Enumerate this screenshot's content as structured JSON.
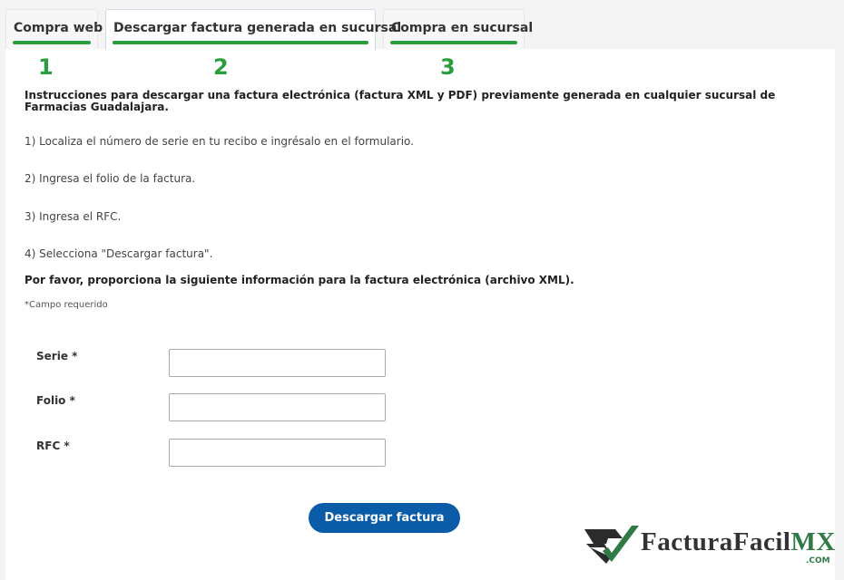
{
  "tabs": [
    {
      "label": "Compra web",
      "active": false
    },
    {
      "label": "Descargar factura generada en sucursal",
      "active": true
    },
    {
      "label": "Compra en sucursal",
      "active": false
    }
  ],
  "step_numbers": [
    "1",
    "2",
    "3"
  ],
  "instructions": {
    "title": "Instrucciones para descargar una factura electrónica (factura XML y PDF) previamente generada en cualquier sucursal de Farmacias Guadalajara.",
    "steps": [
      "1) Localiza el número de serie en tu recibo e ingrésalo en el formulario.",
      "2) Ingresa el folio de la factura.",
      "3) Ingresa el RFC.",
      "4) Selecciona \"Descargar factura\"."
    ]
  },
  "form": {
    "intro": "Por favor, proporciona la siguiente información para la factura electrónica (archivo XML).",
    "required_note": "*Campo requerido",
    "fields": [
      {
        "label": "Serie *",
        "value": ""
      },
      {
        "label": "Folio *",
        "value": ""
      },
      {
        "label": "RFC *",
        "value": ""
      }
    ],
    "submit_label": "Descargar factura"
  },
  "logo": {
    "text_main": "FacturaFacil",
    "text_accent": "MX",
    "sub": ".COM"
  },
  "colors": {
    "accent_green": "#2a9d3f",
    "button_blue": "#0a5ba8",
    "logo_green": "#2f7a45"
  }
}
